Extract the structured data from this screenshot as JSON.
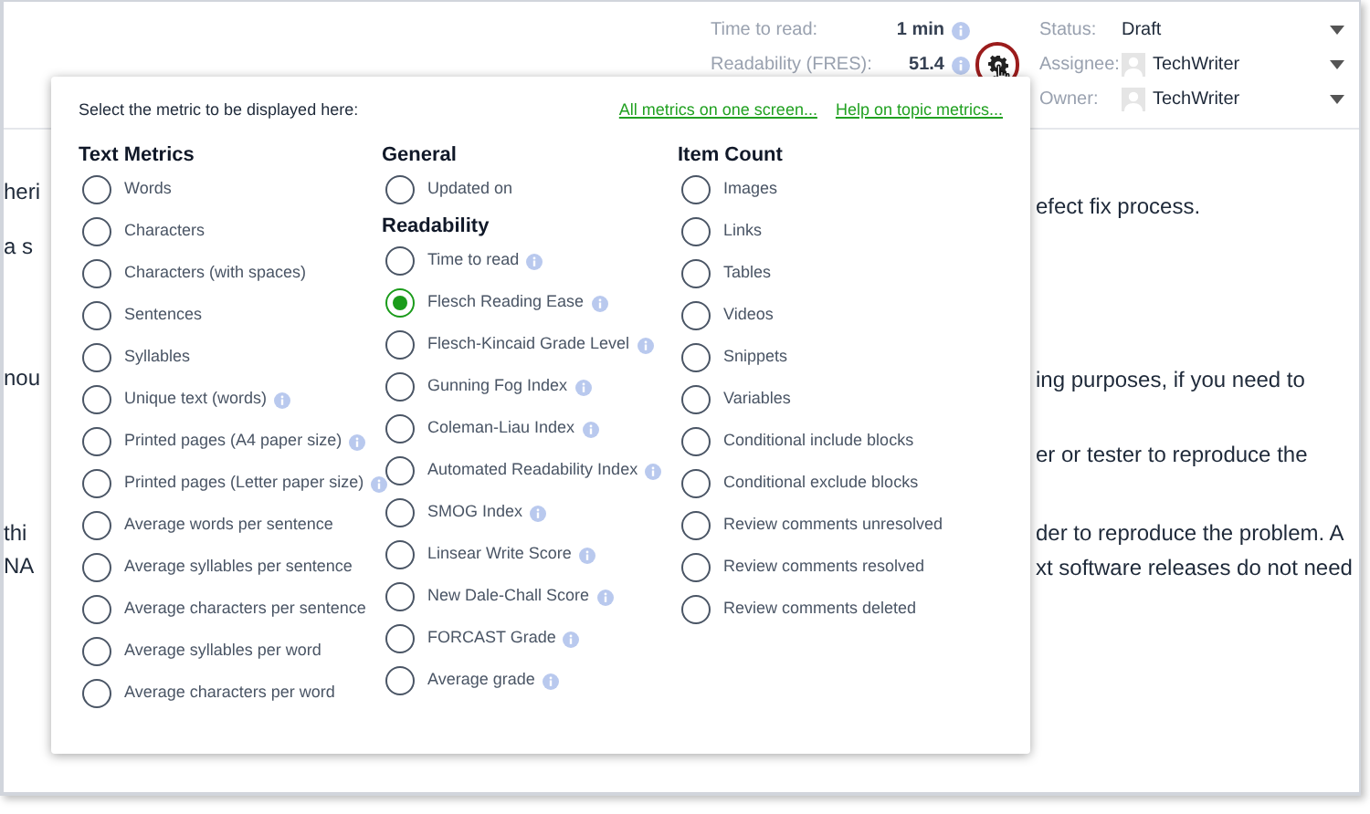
{
  "header": {
    "metrics": [
      {
        "label": "Time to read:",
        "value": "1 min",
        "info": true,
        "settings": false
      },
      {
        "label": "Readability (FRES):",
        "value": "51.4",
        "info": true,
        "settings": true
      }
    ],
    "settings_highlighted": true,
    "fields": [
      {
        "label": "Status:",
        "kind": "text",
        "value": "Draft"
      },
      {
        "label": "Assignee:",
        "kind": "user",
        "value": "TechWriter"
      },
      {
        "label": "Owner:",
        "kind": "user",
        "value": "TechWriter"
      }
    ]
  },
  "background_text": {
    "left": [
      "heri",
      "a s",
      "nou",
      "thi",
      "NA"
    ],
    "right": [
      "efect fix process.",
      "ing purposes, if you need to",
      "er or tester to reproduce the",
      "der to reproduce the problem. A",
      "xt software releases do not need"
    ]
  },
  "popup": {
    "prompt": "Select the metric to be displayed here:",
    "links": [
      "All metrics on one screen...",
      "Help on topic metrics..."
    ],
    "columns": [
      {
        "groups": [
          {
            "heading": "Text Metrics",
            "options": [
              {
                "label": "Words",
                "info": false,
                "selected": false
              },
              {
                "label": "Characters",
                "info": false,
                "selected": false
              },
              {
                "label": "Characters (with spaces)",
                "info": false,
                "selected": false
              },
              {
                "label": "Sentences",
                "info": false,
                "selected": false
              },
              {
                "label": "Syllables",
                "info": false,
                "selected": false
              },
              {
                "label": "Unique text (words)",
                "info": true,
                "selected": false
              },
              {
                "label": "Printed pages (A4 paper size)",
                "info": true,
                "selected": false
              },
              {
                "label": "Printed pages (Letter paper size)",
                "info": true,
                "selected": false
              },
              {
                "label": "Average words per sentence",
                "info": false,
                "selected": false
              },
              {
                "label": "Average syllables per sentence",
                "info": false,
                "selected": false
              },
              {
                "label": "Average characters per sentence",
                "info": false,
                "selected": false
              },
              {
                "label": "Average syllables per word",
                "info": false,
                "selected": false
              },
              {
                "label": "Average characters per word",
                "info": false,
                "selected": false
              }
            ]
          }
        ]
      },
      {
        "groups": [
          {
            "heading": "General",
            "options": [
              {
                "label": "Updated on",
                "info": false,
                "selected": false
              }
            ]
          },
          {
            "heading": "Readability",
            "options": [
              {
                "label": "Time to read",
                "info": true,
                "selected": false
              },
              {
                "label": "Flesch Reading Ease",
                "info": true,
                "selected": true
              },
              {
                "label": "Flesch-Kincaid Grade Level",
                "info": true,
                "selected": false
              },
              {
                "label": "Gunning Fog Index",
                "info": true,
                "selected": false
              },
              {
                "label": "Coleman-Liau Index",
                "info": true,
                "selected": false
              },
              {
                "label": "Automated Readability Index",
                "info": true,
                "selected": false
              },
              {
                "label": "SMOG Index",
                "info": true,
                "selected": false
              },
              {
                "label": "Linsear Write Score",
                "info": true,
                "selected": false
              },
              {
                "label": "New Dale-Chall Score",
                "info": true,
                "selected": false
              },
              {
                "label": "FORCAST Grade",
                "info": true,
                "selected": false
              },
              {
                "label": "Average grade",
                "info": true,
                "selected": false
              }
            ]
          }
        ]
      },
      {
        "groups": [
          {
            "heading": "Item Count",
            "options": [
              {
                "label": "Images",
                "info": false,
                "selected": false
              },
              {
                "label": "Links",
                "info": false,
                "selected": false
              },
              {
                "label": "Tables",
                "info": false,
                "selected": false
              },
              {
                "label": "Videos",
                "info": false,
                "selected": false
              },
              {
                "label": "Snippets",
                "info": false,
                "selected": false
              },
              {
                "label": "Variables",
                "info": false,
                "selected": false
              },
              {
                "label": "Conditional include blocks",
                "info": false,
                "selected": false
              },
              {
                "label": "Conditional exclude blocks",
                "info": false,
                "selected": false
              },
              {
                "label": "Review comments unresolved",
                "info": false,
                "selected": false
              },
              {
                "label": "Review comments resolved",
                "info": false,
                "selected": false
              },
              {
                "label": "Review comments deleted",
                "info": false,
                "selected": false
              }
            ]
          }
        ]
      }
    ]
  }
}
